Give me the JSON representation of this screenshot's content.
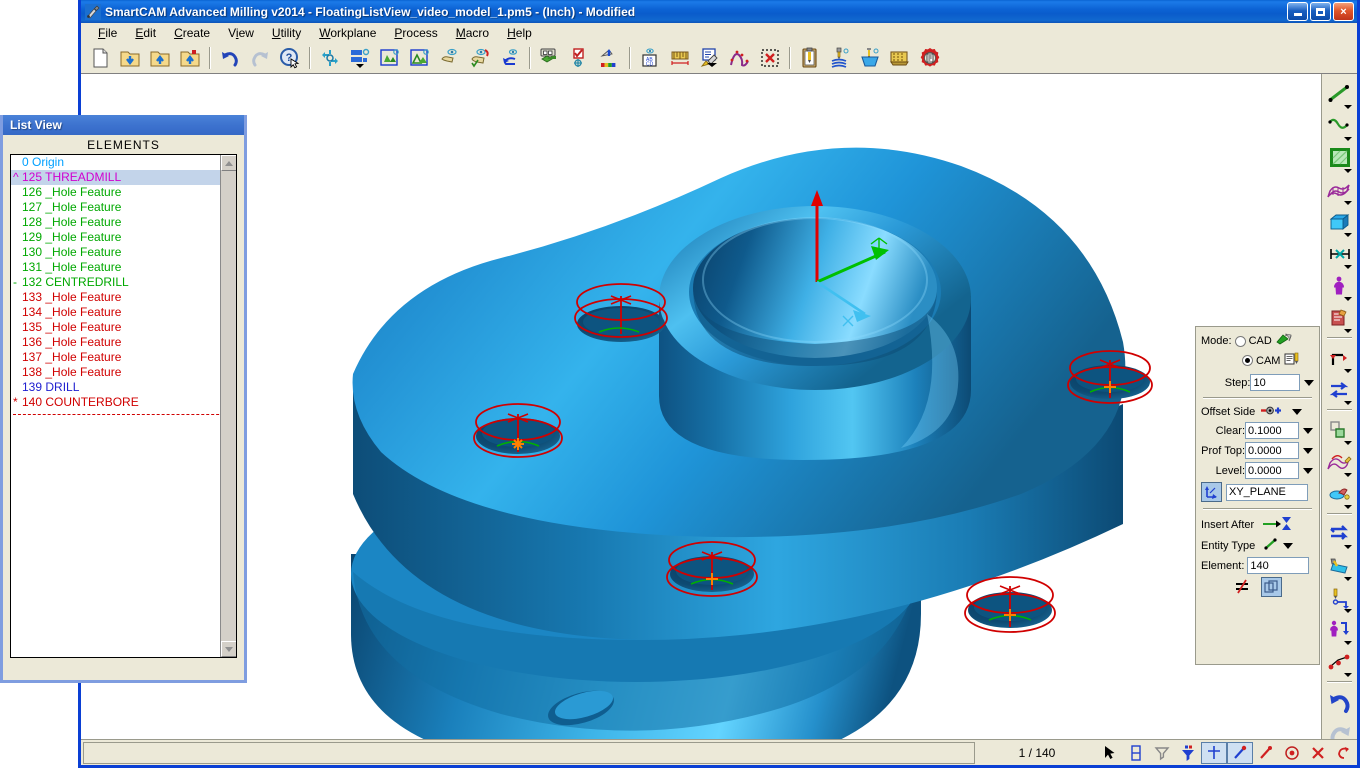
{
  "window": {
    "title": "SmartCAM Advanced Milling v2014 - FloatingListView_video_model_1.pm5 - (Inch) - Modified",
    "icon": "smartcam-app-icon",
    "buttons": {
      "minimize": "minimize-button",
      "maximize": "maximize-button",
      "close": "close-button",
      "close_label": "×"
    }
  },
  "menu": {
    "items": [
      {
        "label": "File",
        "accel": "F"
      },
      {
        "label": "Edit",
        "accel": "E"
      },
      {
        "label": "Create",
        "accel": "C"
      },
      {
        "label": "View",
        "accel": "i"
      },
      {
        "label": "Utility",
        "accel": "U"
      },
      {
        "label": "Workplane",
        "accel": "W"
      },
      {
        "label": "Process",
        "accel": "P"
      },
      {
        "label": "Macro",
        "accel": "M"
      },
      {
        "label": "Help",
        "accel": "H"
      }
    ]
  },
  "toolbar": {
    "items": [
      {
        "name": "new-file-icon",
        "type": "button"
      },
      {
        "name": "open-file-icon",
        "type": "button"
      },
      {
        "name": "save-file-icon",
        "type": "button"
      },
      {
        "name": "save-as-file-icon",
        "type": "button"
      },
      {
        "name": "separator-1",
        "type": "separator"
      },
      {
        "name": "undo-icon",
        "type": "button"
      },
      {
        "name": "redo-icon",
        "type": "button"
      },
      {
        "name": "help-cursor-icon",
        "type": "button"
      },
      {
        "name": "separator-2",
        "type": "separator"
      },
      {
        "name": "zoom-all-icon",
        "type": "button"
      },
      {
        "name": "view-layout-icon",
        "type": "button"
      },
      {
        "name": "shaded-view-icon",
        "type": "button"
      },
      {
        "name": "wireframe-view-icon",
        "type": "button"
      },
      {
        "name": "view-hidden-icon",
        "type": "button"
      },
      {
        "name": "view-display-icon",
        "type": "button"
      },
      {
        "name": "restore-view-icon",
        "type": "button"
      },
      {
        "name": "separator-3",
        "type": "separator"
      },
      {
        "name": "layer-manager-icon",
        "type": "button"
      },
      {
        "name": "verify-icon",
        "type": "button"
      },
      {
        "name": "color-palette-icon",
        "type": "button"
      },
      {
        "name": "separator-4",
        "type": "separator"
      },
      {
        "name": "text-entity-icon",
        "type": "button"
      },
      {
        "name": "dimension-icon",
        "type": "button"
      },
      {
        "name": "annotate-icon",
        "type": "button"
      },
      {
        "name": "spline-icon",
        "type": "button"
      },
      {
        "name": "delete-icon",
        "type": "button"
      },
      {
        "name": "separator-5",
        "type": "separator"
      },
      {
        "name": "tool-library-icon",
        "type": "button"
      },
      {
        "name": "drill-cycle-icon",
        "type": "button"
      },
      {
        "name": "pocket-icon",
        "type": "button"
      },
      {
        "name": "post-process-icon",
        "type": "button"
      },
      {
        "name": "machine-setup-icon",
        "type": "button"
      }
    ]
  },
  "right_toolbar": {
    "items": [
      {
        "name": "create-line-icon",
        "caret": true
      },
      {
        "name": "create-spline-icon",
        "caret": true
      },
      {
        "name": "create-surface-icon",
        "caret": true,
        "active": true
      },
      {
        "name": "create-mesh-icon",
        "caret": true
      },
      {
        "name": "create-solid-icon",
        "caret": true
      },
      {
        "name": "measure-icon",
        "caret": true
      },
      {
        "name": "figure-icon",
        "caret": true
      },
      {
        "name": "text-tool-icon",
        "caret": true
      },
      {
        "name": "separator-a",
        "type": "separator"
      },
      {
        "name": "move-transform-icon",
        "caret": true
      },
      {
        "name": "mirror-icon",
        "caret": true
      },
      {
        "name": "separator-b",
        "type": "separator"
      },
      {
        "name": "trim-corner-icon",
        "caret": true
      },
      {
        "name": "surface-edit-icon",
        "caret": true
      },
      {
        "name": "shape-edit-icon",
        "caret": true
      },
      {
        "name": "separator-c",
        "type": "separator"
      },
      {
        "name": "offset-profile-icon",
        "caret": true
      },
      {
        "name": "milling-process-icon",
        "caret": true
      },
      {
        "name": "drill-process-icon",
        "caret": true
      },
      {
        "name": "figure-process-icon",
        "caret": true
      },
      {
        "name": "point-process-icon",
        "caret": true
      },
      {
        "name": "separator-d",
        "type": "separator"
      },
      {
        "name": "undo-large-icon",
        "caret": false
      },
      {
        "name": "redo-large-icon",
        "caret": false
      }
    ]
  },
  "list_view": {
    "title": "List View",
    "header": "ELEMENTS",
    "rows": [
      {
        "prefix": "",
        "num": "0",
        "label": "Origin",
        "color": "#00a0ff",
        "selected": false
      },
      {
        "prefix": "^",
        "num": "125",
        "label": "THREADMILL",
        "color": "#d000d0",
        "selected": true
      },
      {
        "prefix": "",
        "num": "126",
        "label": "_Hole Feature",
        "color": "#00a800",
        "selected": false
      },
      {
        "prefix": "",
        "num": "127",
        "label": "_Hole Feature",
        "color": "#00a800",
        "selected": false
      },
      {
        "prefix": "",
        "num": "128",
        "label": "_Hole Feature",
        "color": "#00a800",
        "selected": false
      },
      {
        "prefix": "",
        "num": "129",
        "label": "_Hole Feature",
        "color": "#00a800",
        "selected": false
      },
      {
        "prefix": "",
        "num": "130",
        "label": "_Hole Feature",
        "color": "#00a800",
        "selected": false
      },
      {
        "prefix": "",
        "num": "131",
        "label": "_Hole Feature",
        "color": "#00a800",
        "selected": false
      },
      {
        "prefix": "-",
        "num": "132",
        "label": "CENTREDRILL",
        "color": "#00a800",
        "selected": false
      },
      {
        "prefix": "",
        "num": "133",
        "label": "_Hole Feature",
        "color": "#d00000",
        "selected": false
      },
      {
        "prefix": "",
        "num": "134",
        "label": "_Hole Feature",
        "color": "#d00000",
        "selected": false
      },
      {
        "prefix": "",
        "num": "135",
        "label": "_Hole Feature",
        "color": "#d00000",
        "selected": false
      },
      {
        "prefix": "",
        "num": "136",
        "label": "_Hole Feature",
        "color": "#d00000",
        "selected": false
      },
      {
        "prefix": "",
        "num": "137",
        "label": "_Hole Feature",
        "color": "#d00000",
        "selected": false
      },
      {
        "prefix": "",
        "num": "138",
        "label": "_Hole Feature",
        "color": "#d00000",
        "selected": false
      },
      {
        "prefix": "",
        "num": "139",
        "label": "DRILL",
        "color": "#2020d0",
        "selected": false
      },
      {
        "prefix": "*",
        "num": "140",
        "label": "COUNTERBORE",
        "color": "#d00000",
        "selected": false
      }
    ],
    "end_marker_color": "#d00000",
    "scrollbar": {
      "up_arrow": "scroll-up-arrow",
      "down_arrow": "scroll-down-arrow"
    }
  },
  "cam_panel": {
    "mode_label": "Mode:",
    "mode_cad": "CAD",
    "mode_cam": "CAM",
    "mode_selected": "CAM",
    "step_label": "Step:",
    "step_value": "10",
    "offset_side_label": "Offset Side",
    "clear_label": "Clear:",
    "clear_value": "0.1000",
    "prof_top_label": "Prof Top:",
    "prof_top_value": "0.0000",
    "level_label": "Level:",
    "level_value": "0.0000",
    "workplane_value": "XY_PLANE",
    "insert_after_label": "Insert After",
    "entity_type_label": "Entity Type",
    "element_label": "Element:",
    "element_value": "140"
  },
  "status_bar": {
    "count": "1 / 140",
    "icons": [
      {
        "name": "select-arrow-icon",
        "active": false
      },
      {
        "name": "element-toggle-icon",
        "active": false
      },
      {
        "name": "filter-off-icon",
        "active": false
      },
      {
        "name": "filter-on-icon",
        "active": false
      },
      {
        "name": "snap-intersection-icon",
        "active": true
      },
      {
        "name": "snap-endpoint-icon",
        "active": true
      },
      {
        "name": "snap-midpoint-icon",
        "active": false
      },
      {
        "name": "snap-center-icon",
        "active": false
      },
      {
        "name": "snap-none-icon",
        "active": false
      },
      {
        "name": "snap-tangent-icon",
        "active": false
      }
    ]
  },
  "colors": {
    "title_blue": "#0a64d2",
    "face_bg": "#ece9d8",
    "model_blue": "#1b8fd4",
    "toolpath_red": "#d00000",
    "axis_z": "#e00000",
    "axis_y": "#00c000",
    "axis_x": "#40c0f0",
    "selection": "#c3d4ea"
  }
}
